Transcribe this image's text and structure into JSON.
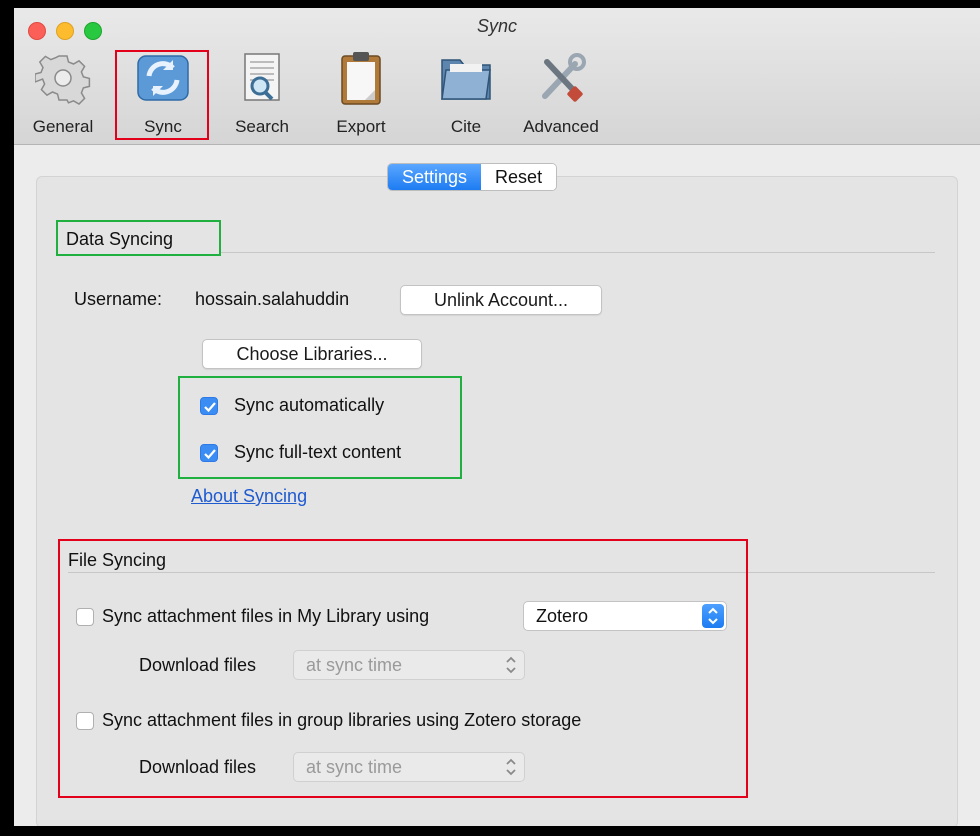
{
  "window": {
    "title": "Sync"
  },
  "toolbar": {
    "items": [
      {
        "label": "General",
        "icon": "gear-icon"
      },
      {
        "label": "Sync",
        "icon": "sync-icon",
        "selected": true
      },
      {
        "label": "Search",
        "icon": "search-document-icon"
      },
      {
        "label": "Export",
        "icon": "clipboard-icon"
      },
      {
        "label": "Cite",
        "icon": "folder-icon"
      },
      {
        "label": "Advanced",
        "icon": "tools-icon"
      }
    ]
  },
  "segmented": {
    "settings_label": "Settings",
    "reset_label": "Reset",
    "selected": "Settings"
  },
  "data_syncing": {
    "heading": "Data Syncing",
    "username_label": "Username:",
    "username_value": "hossain.salahuddin",
    "unlink_button": "Unlink Account...",
    "choose_libraries_button": "Choose Libraries...",
    "sync_automatically": {
      "label": "Sync automatically",
      "checked": true
    },
    "sync_fulltext": {
      "label": "Sync full-text content",
      "checked": true
    },
    "about_link": "About Syncing"
  },
  "file_syncing": {
    "heading": "File Syncing",
    "my_library": {
      "label": "Sync attachment files in My Library using",
      "checked": false,
      "service": "Zotero",
      "download_label": "Download files",
      "download_value": "at sync time"
    },
    "group_libraries": {
      "label": "Sync attachment files in group libraries using Zotero storage",
      "checked": false,
      "download_label": "Download files",
      "download_value": "at sync time"
    }
  },
  "colors": {
    "accent": "#1d7cf2",
    "highlight_red": "#e3001b",
    "highlight_green": "#1fb040",
    "link": "#1e5ad0"
  }
}
